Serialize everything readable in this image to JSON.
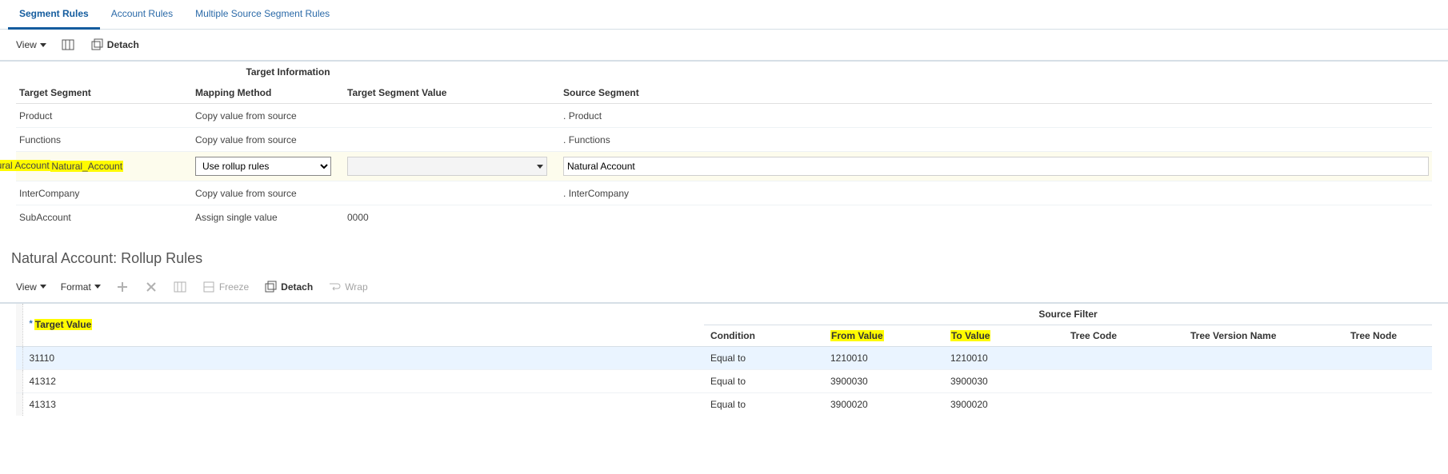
{
  "tabs": {
    "segment_rules": "Segment Rules",
    "account_rules": "Account Rules",
    "multi_source": "Multiple Source Segment Rules"
  },
  "toolbar": {
    "view": "View",
    "detach": "Detach",
    "format": "Format",
    "freeze": "Freeze",
    "wrap": "Wrap"
  },
  "seg_headers": {
    "target_info": "Target Information",
    "target_segment": "Target Segment",
    "mapping_method": "Mapping Method",
    "target_segment_value": "Target Segment Value",
    "source_segment": "Source Segment"
  },
  "mapping_options": {
    "copy": "Copy value from source",
    "rollup": "Use rollup rules",
    "single": "Assign single value"
  },
  "seg_rows": {
    "product_top": {
      "target": "Product",
      "method": "Copy value from source",
      "source": "Product"
    },
    "functions": {
      "target": "Functions",
      "method": "Copy value from source",
      "source": "Functions"
    },
    "natural": {
      "target": "Natural_Account",
      "method": "Use rollup rules",
      "source": "Natural Account"
    },
    "inter": {
      "target": "InterCompany",
      "method": "Copy value from source",
      "source": "InterCompany"
    },
    "sub": {
      "target": "SubAccount",
      "method": "Assign single value",
      "val": "0000",
      "source": ""
    }
  },
  "rollup_title": "Natural Account: Rollup Rules",
  "rollup_headers": {
    "target_value": "Target Value",
    "source_filter": "Source Filter",
    "condition": "Condition",
    "from_value": "From Value",
    "to_value": "To Value",
    "tree_code": "Tree Code",
    "tree_version": "Tree Version Name",
    "tree_node": "Tree Node"
  },
  "rollup_rows": [
    {
      "target": "31110",
      "cond": "Equal to",
      "from": "1210010",
      "to": "1210010"
    },
    {
      "target": "41312",
      "cond": "Equal to",
      "from": "3900030",
      "to": "3900030"
    },
    {
      "target": "41313",
      "cond": "Equal to",
      "from": "3900020",
      "to": "3900020"
    }
  ]
}
